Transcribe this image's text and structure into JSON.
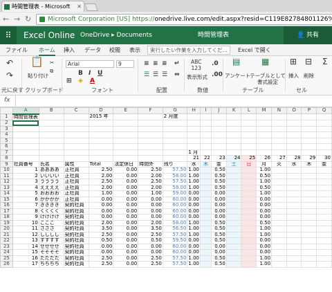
{
  "browser": {
    "tab_title": "時間管理表 - Microsoft",
    "ev_name": "Microsoft Corporation [US]",
    "url_scheme": "https://",
    "url_rest": "onedrive.live.com/edit.aspx?resid=C119E82784801126%211717"
  },
  "appbar": {
    "app_name": "Excel Online",
    "breadcrumb": "OneDrive ▸ Documents",
    "doc_title": "時間管理表",
    "share_label": "共有",
    "share_icon": "person-icon"
  },
  "menu": {
    "items": [
      "ファイル",
      "ホーム",
      "挿入",
      "データ",
      "校閲",
      "表示"
    ],
    "active": "ホーム",
    "tell_me": "実行したい作業を入力してくだ…",
    "open_in_excel": "Excel で開く"
  },
  "ribbon": {
    "undo_group": "元に戻す",
    "clipboard_group": "クリップボード",
    "paste_label": "貼り付け",
    "font_group": "フォント",
    "font_name": "Arial",
    "font_size": "9",
    "align_group": "配置",
    "number_group": "数値",
    "number_format": "表示形式",
    "abc_label": "ABC\n123",
    "table_group": "テーブル",
    "survey_label": "アンケート",
    "format_as_table": "テーブルとして書式設定",
    "cells_group": "セル",
    "insert_label": "挿入",
    "delete_label": "削除",
    "sum_symbol": "Σ"
  },
  "formula_bar": {
    "fx": "fx",
    "value": ""
  },
  "sheet": {
    "columns": [
      "A",
      "B",
      "C",
      "D",
      "E",
      "F",
      "G",
      "H",
      "I",
      "J",
      "K",
      "L",
      "M",
      "N",
      "O",
      "P",
      "Q"
    ],
    "selected_column": "A",
    "title_row": {
      "title": "時間管理表",
      "year": "2015 年",
      "month": "2 月度"
    },
    "month_label": "1 月",
    "day_numbers": [
      "21",
      "22",
      "23",
      "24",
      "25",
      "26",
      "27",
      "28",
      "29",
      "30"
    ],
    "weekdays": [
      "水",
      "木",
      "金",
      "土",
      "日",
      "月",
      "火",
      "水",
      "木",
      "金"
    ],
    "headers": [
      "社員番号",
      "氏名",
      "属性",
      "Total",
      "法定休日",
      "時間外",
      "残り"
    ],
    "rows": [
      {
        "n": "1",
        "name": "ああああ",
        "type": "正社員",
        "total": "2.50",
        "holiday": "0.00",
        "ot": "2.50",
        "rest": "57.50",
        "days": [
          "1.00",
          "",
          "0.50",
          "",
          "",
          "1.00",
          "",
          "",
          "",
          ""
        ]
      },
      {
        "n": "2",
        "name": "いいいい",
        "type": "正社員",
        "total": "2.00",
        "holiday": "0.00",
        "ot": "2.00",
        "rest": "58.00",
        "days": [
          "1.00",
          "",
          "0.50",
          "",
          "",
          "0.50",
          "",
          "",
          "",
          ""
        ]
      },
      {
        "n": "3",
        "name": "うううう",
        "type": "正社員",
        "total": "2.50",
        "holiday": "0.00",
        "ot": "2.50",
        "rest": "57.50",
        "days": [
          "1.00",
          "",
          "0.50",
          "",
          "",
          "1.00",
          "",
          "",
          "",
          ""
        ]
      },
      {
        "n": "4",
        "name": "ええええ",
        "type": "正社員",
        "total": "2.00",
        "holiday": "0.00",
        "ot": "2.00",
        "rest": "58.00",
        "days": [
          "1.00",
          "",
          "0.50",
          "",
          "",
          "0.50",
          "",
          "",
          "",
          ""
        ]
      },
      {
        "n": "5",
        "name": "おおおお",
        "type": "正社員",
        "total": "1.00",
        "holiday": "0.00",
        "ot": "1.00",
        "rest": "59.00",
        "days": [
          "0.00",
          "",
          "0.00",
          "",
          "",
          "1.00",
          "",
          "",
          "",
          ""
        ]
      },
      {
        "n": "6",
        "name": "かかかか",
        "type": "正社員",
        "total": "0.00",
        "holiday": "0.00",
        "ot": "0.00",
        "rest": "60.00",
        "days": [
          "0.00",
          "",
          "0.00",
          "",
          "",
          "0.00",
          "",
          "",
          "",
          ""
        ]
      },
      {
        "n": "7",
        "name": "きききき",
        "type": "契約社員",
        "total": "0.00",
        "holiday": "0.00",
        "ot": "0.00",
        "rest": "60.00",
        "days": [
          "0.00",
          "",
          "0.00",
          "",
          "",
          "0.00",
          "",
          "",
          "",
          ""
        ]
      },
      {
        "n": "8",
        "name": "くくくく",
        "type": "契約社員",
        "total": "0.00",
        "holiday": "0.00",
        "ot": "0.00",
        "rest": "60.00",
        "days": [
          "0.00",
          "",
          "0.00",
          "",
          "",
          "0.00",
          "",
          "",
          "",
          ""
        ]
      },
      {
        "n": "9",
        "name": "けけけけ",
        "type": "契約社員",
        "total": "0.00",
        "holiday": "0.00",
        "ot": "0.00",
        "rest": "60.00",
        "days": [
          "0.00",
          "",
          "0.00",
          "",
          "",
          "0.00",
          "",
          "",
          "",
          ""
        ]
      },
      {
        "n": "10",
        "name": "こここ",
        "type": "契約社員",
        "total": "2.00",
        "holiday": "0.00",
        "ot": "2.00",
        "rest": "58.00",
        "days": [
          "1.00",
          "",
          "0.50",
          "",
          "",
          "0.50",
          "",
          "",
          "",
          ""
        ]
      },
      {
        "n": "11",
        "name": "さささ",
        "type": "契約社員",
        "total": "3.50",
        "holiday": "0.00",
        "ot": "3.50",
        "rest": "56.50",
        "days": [
          "1.00",
          "",
          "0.50",
          "",
          "",
          "1.00",
          "",
          "",
          "",
          ""
        ]
      },
      {
        "n": "12",
        "name": "しししし",
        "type": "契約社員",
        "total": "2.50",
        "holiday": "0.00",
        "ot": "2.50",
        "rest": "57.50",
        "days": [
          "1.00",
          "",
          "0.50",
          "",
          "",
          "1.00",
          "",
          "",
          "",
          ""
        ]
      },
      {
        "n": "13",
        "name": "すすすす",
        "type": "契約社員",
        "total": "0.50",
        "holiday": "0.00",
        "ot": "0.50",
        "rest": "59.50",
        "days": [
          "0.00",
          "",
          "0.50",
          "",
          "",
          "0.00",
          "",
          "",
          "",
          ""
        ]
      },
      {
        "n": "14",
        "name": "せせせせ",
        "type": "契約社員",
        "total": "0.00",
        "holiday": "0.00",
        "ot": "0.00",
        "rest": "60.00",
        "days": [
          "0.00",
          "",
          "0.00",
          "",
          "",
          "0.00",
          "",
          "",
          "",
          ""
        ]
      },
      {
        "n": "15",
        "name": "そそそそ",
        "type": "契約社員",
        "total": "0.00",
        "holiday": "0.00",
        "ot": "0.00",
        "rest": "60.00",
        "days": [
          "0.00",
          "",
          "0.00",
          "",
          "",
          "0.00",
          "",
          "",
          "",
          ""
        ]
      },
      {
        "n": "16",
        "name": "たたたた",
        "type": "契約社員",
        "total": "2.50",
        "holiday": "0.00",
        "ot": "2.50",
        "rest": "57.50",
        "days": [
          "1.00",
          "",
          "0.50",
          "",
          "",
          "1.00",
          "",
          "",
          "",
          ""
        ]
      },
      {
        "n": "17",
        "name": "ちちちち",
        "type": "契約社員",
        "total": "2.50",
        "holiday": "0.00",
        "ot": "2.50",
        "rest": "57.50",
        "days": [
          "1.00",
          "",
          "0.50",
          "",
          "",
          "1.00",
          "",
          "",
          "",
          ""
        ]
      }
    ]
  }
}
